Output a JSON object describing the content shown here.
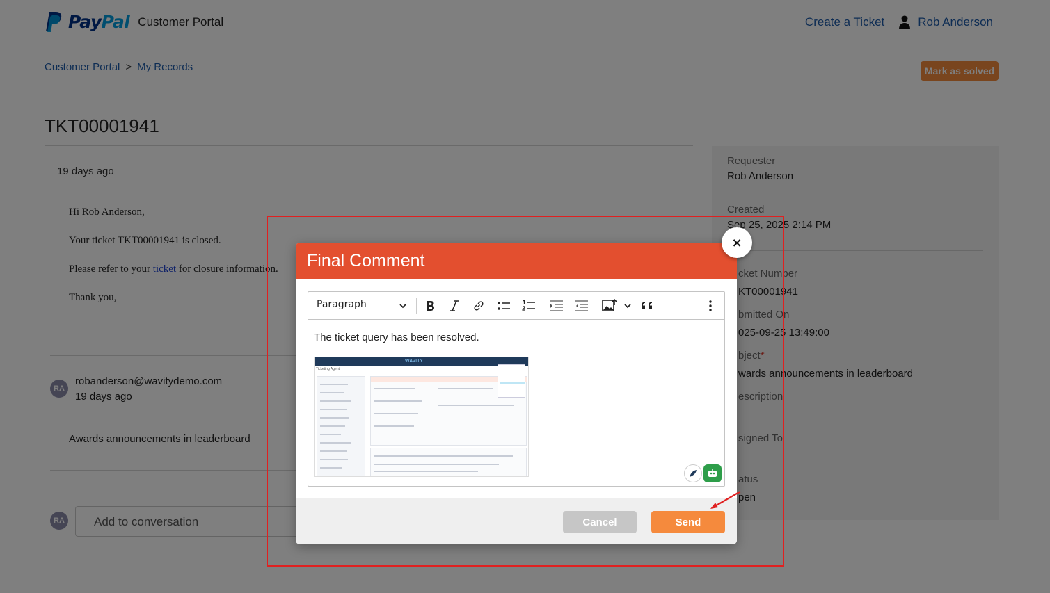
{
  "header": {
    "brand_pay": "Pay",
    "brand_pal": "Pal",
    "portal_name": "Customer Portal",
    "create_ticket": "Create a Ticket",
    "user_name": "Rob Anderson"
  },
  "breadcrumb": {
    "root": "Customer Portal",
    "separator": ">",
    "current": "My Records"
  },
  "actions": {
    "mark_solved": "Mark as solved"
  },
  "ticket": {
    "number": "TKT00001941",
    "first_time": "19 days ago",
    "email_lines": {
      "greeting": "Hi Rob Anderson,",
      "closed": "Your ticket TKT00001941 is closed.",
      "refer_prefix": "Please refer to your ",
      "refer_link": "ticket",
      "refer_suffix": " for closure information.",
      "thanks": "Thank you,"
    },
    "message": {
      "avatar": "RA",
      "email": "robanderson@wavitydemo.com",
      "time": "19 days ago",
      "text": "Awards announcements in leaderboard"
    },
    "composer": {
      "avatar": "RA",
      "placeholder": "Add to conversation"
    }
  },
  "side_panel": {
    "requester_label": "Requester",
    "requester_value": "Rob Anderson",
    "created_label": "Created",
    "created_value": "Sep 25, 2025 2:14 PM",
    "ticket_number_label": "cket Number",
    "ticket_number_value": "KT00001941",
    "submitted_label": "bmitted On",
    "submitted_value": "025-09-25 13:49:00",
    "subject_label": "bject",
    "subject_required": "*",
    "subject_value": "wards announcements in leaderboard",
    "description_label": "escription",
    "assigned_label": "signed To",
    "status_label": "atus",
    "status_value": "pen"
  },
  "modal": {
    "title": "Final Comment",
    "close": "×",
    "toolbar": {
      "paragraph": "Paragraph"
    },
    "body_text": "The ticket query has been resolved.",
    "image": {
      "brand": "WAVITY",
      "sub": "Ticketing Agent"
    },
    "cancel": "Cancel",
    "send": "Send"
  },
  "colors": {
    "modal_header": "#e34f2f",
    "send": "#f58a3d",
    "link": "#1d5aa8",
    "highlight": "#e02020"
  }
}
